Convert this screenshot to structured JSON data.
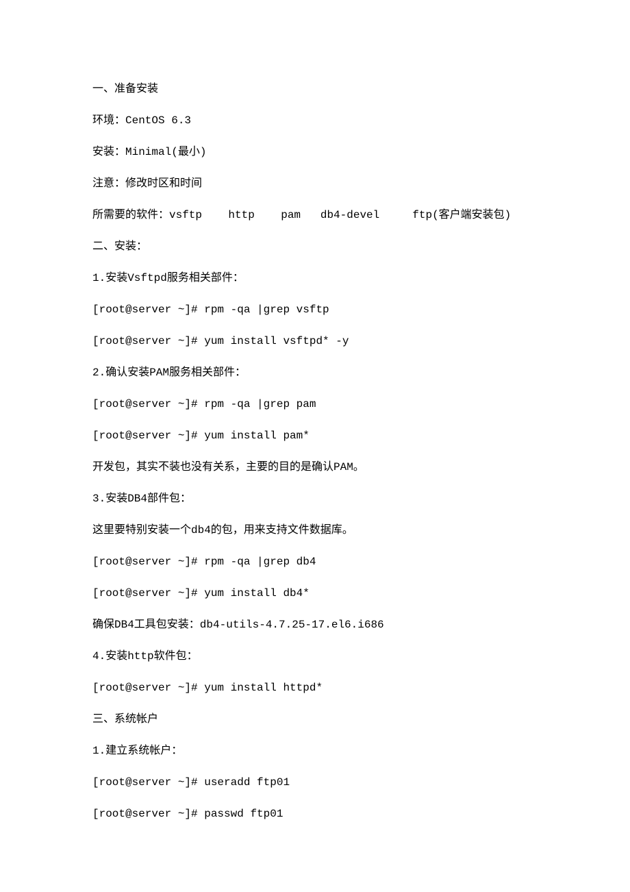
{
  "paragraphs": [
    "一、准备安装",
    "环境：CentOS 6.3",
    "安装：Minimal(最小)",
    "注意：修改时区和时间",
    "所需要的软件：vsftp    http    pam   db4-devel     ftp(客户端安装包)",
    "二、安装：",
    "1.安装Vsftpd服务相关部件：",
    "[root@server ~]# rpm -qa |grep vsftp",
    "[root@server ~]# yum install vsftpd* -y",
    "2.确认安装PAM服务相关部件：",
    "[root@server ~]# rpm -qa |grep pam",
    "[root@server ~]# yum install pam*",
    "开发包，其实不装也没有关系，主要的目的是确认PAM。",
    "3.安装DB4部件包：",
    "这里要特别安装一个db4的包，用来支持文件数据库。",
    "[root@server ~]# rpm -qa |grep db4",
    "[root@server ~]# yum install db4*",
    "确保DB4工具包安装：db4-utils-4.7.25-17.el6.i686",
    "4.安装http软件包：",
    "[root@server ~]# yum install httpd*",
    "三、系统帐户",
    "1.建立系统帐户：",
    "[root@server ~]# useradd ftp01",
    "[root@server ~]# passwd ftp01"
  ]
}
